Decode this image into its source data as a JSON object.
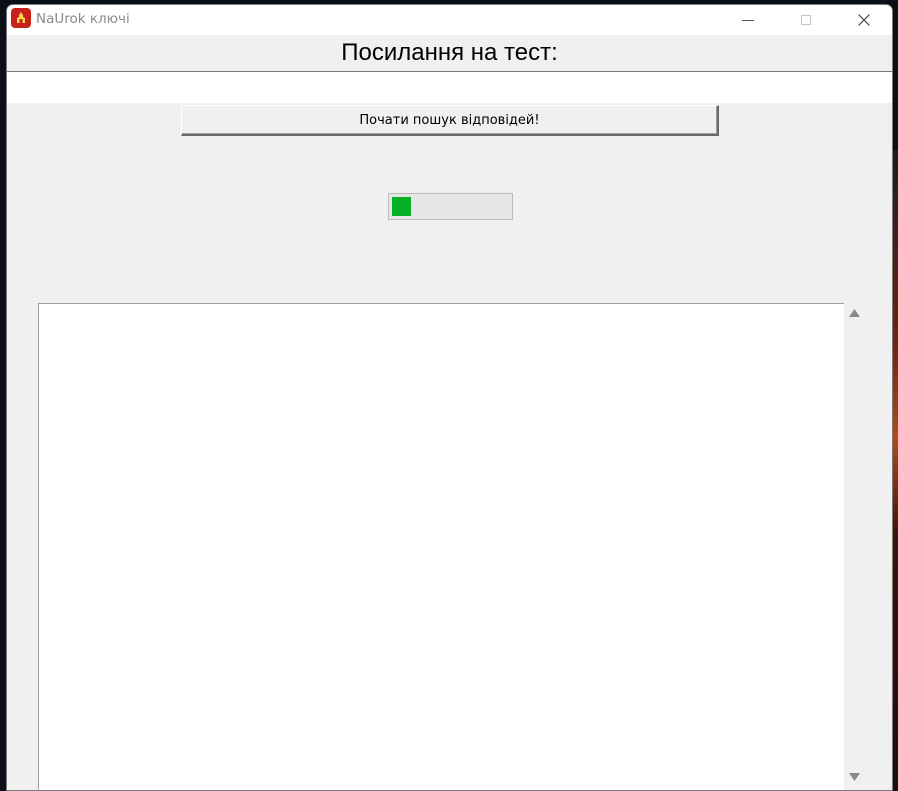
{
  "window": {
    "title": "NaUrok ключі",
    "icon": "naurok-app-icon",
    "controls": [
      "minimize-icon",
      "maximize-icon",
      "close-icon"
    ]
  },
  "form": {
    "heading": "Посилання на тест:",
    "link_value": "",
    "search_button_label": "Почати пошук відповідей!"
  },
  "progress": {
    "fraction": 0.16,
    "color": "#06b025"
  },
  "output": {
    "text": ""
  },
  "colors": {
    "window_bg": "#f0f0f0",
    "app_icon": "#c8201b"
  }
}
